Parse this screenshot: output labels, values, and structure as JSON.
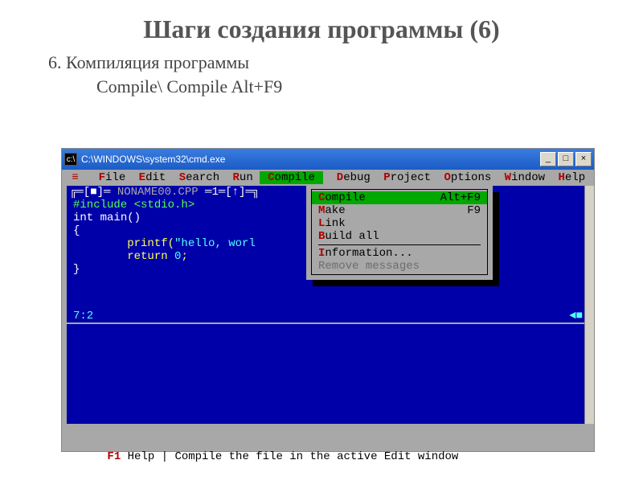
{
  "slide": {
    "title": "Шаги создания программы (6)",
    "subtitle1": "6. Компиляция программы",
    "subtitle2": "Compile\\ Compile Alt+F9"
  },
  "window": {
    "title": "C:\\WINDOWS\\system32\\cmd.exe",
    "buttons": {
      "min": "_",
      "max": "□",
      "close": "×"
    }
  },
  "menubar": {
    "items": [
      {
        "hot": "≡",
        "rest": ""
      },
      {
        "hot": "F",
        "rest": "ile"
      },
      {
        "hot": "E",
        "rest": "dit"
      },
      {
        "hot": "S",
        "rest": "earch"
      },
      {
        "hot": "R",
        "rest": "un"
      },
      {
        "hot": "C",
        "rest": "ompile",
        "active": true
      },
      {
        "hot": "D",
        "rest": "ebug"
      },
      {
        "hot": "P",
        "rest": "roject"
      },
      {
        "hot": "O",
        "rest": "ptions"
      },
      {
        "hot": "W",
        "rest": "indow"
      },
      {
        "hot": "H",
        "rest": "elp"
      }
    ]
  },
  "editor": {
    "frame_left": "╔═[■]═",
    "frame_file": " NONAME00.CPP ",
    "frame_right": "═1═[↑]═╗",
    "code": {
      "l1a": "#include ",
      "l1b": "<stdio.h>",
      "l2": "",
      "l3a": "int ",
      "l3b": "main",
      "l3c": "()",
      "l4": "{",
      "l5a": "        printf",
      "l5b": "(",
      "l5c": "\"hello, worl",
      "l6a": "        return ",
      "l6b": "0",
      "l6c": ";",
      "l7": "}"
    },
    "cursor_pos": "7:2",
    "scroll_marks": "◄■"
  },
  "dropdown": {
    "items": [
      {
        "hot": "C",
        "rest": "ompile",
        "shortcut": "Alt+F9",
        "selected": true
      },
      {
        "hot": "M",
        "rest": "ake",
        "shortcut": "F9"
      },
      {
        "hot": "L",
        "rest": "ink",
        "shortcut": ""
      },
      {
        "hot": "B",
        "rest": "uild all",
        "shortcut": ""
      }
    ],
    "items2": [
      {
        "hot": "I",
        "rest": "nformation...",
        "shortcut": ""
      },
      {
        "hot": "",
        "rest": "Remove messages",
        "shortcut": "",
        "disabled": true
      }
    ]
  },
  "status": {
    "f1_hot": "F1",
    "text": " Help | Compile the file in the active Edit window"
  }
}
